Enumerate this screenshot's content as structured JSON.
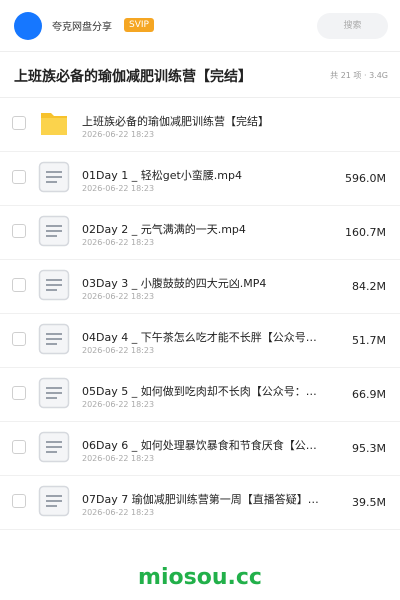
{
  "header": {
    "brand": "夸克网盘分享",
    "badge": "SVIP",
    "search_placeholder": "搜索"
  },
  "folder": {
    "title": "上班族必备的瑜伽减肥训练营【完结】",
    "meta": "共 21 项 · 3.4G"
  },
  "items": [
    {
      "type": "folder",
      "name": "上班族必备的瑜伽减肥训练营【完结】",
      "date": "2026-06-22 18:23",
      "size": ""
    },
    {
      "type": "file",
      "name": "01Day 1 _ 轻松get小蛮腰.mp4",
      "date": "2026-06-22 18:23",
      "size": "596.0M"
    },
    {
      "type": "file",
      "name": "02Day 2 _ 元气满满的一天.mp4",
      "date": "2026-06-22 18:23",
      "size": "160.7M"
    },
    {
      "type": "file",
      "name": "03Day 3 _ 小腹鼓鼓的四大元凶.MP4",
      "date": "2026-06-22 18:23",
      "size": "84.2M"
    },
    {
      "type": "file",
      "name": "04Day 4 _ 下午茶怎么吃才能不长胖【公众号…",
      "date": "2026-06-22 18:23",
      "size": "51.7M"
    },
    {
      "type": "file",
      "name": "05Day 5 _ 如何做到吃肉却不长肉【公众号：…",
      "date": "2026-06-22 18:23",
      "size": "66.9M"
    },
    {
      "type": "file",
      "name": "06Day 6 _ 如何处理暴饮暴食和节食厌食【公…",
      "date": "2026-06-22 18:23",
      "size": "95.3M"
    },
    {
      "type": "file",
      "name": "07Day 7 瑜伽减肥训练营第一周【直播答疑】…",
      "date": "2026-06-22 18:23",
      "size": "39.5M"
    }
  ],
  "footer": {
    "logo": "miosou.cc"
  },
  "colors": {
    "accent": "#1677ff",
    "badge": "#f5a623",
    "folder": "#f7c22c",
    "logo": "#22b04a"
  }
}
